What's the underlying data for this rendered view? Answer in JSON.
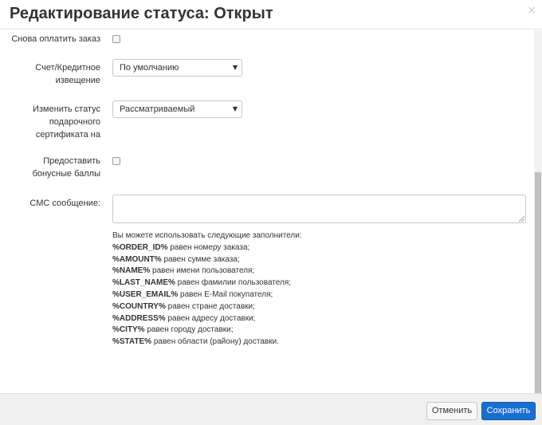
{
  "header": {
    "title": "Редактирование статуса: Открыт",
    "close_symbol": "×"
  },
  "form": {
    "repay_order": {
      "label": "Снова оплатить заказ",
      "checked": false
    },
    "invoice": {
      "label": "Счет/Кредитное извещение",
      "value": "По умолчанию"
    },
    "gift_cert": {
      "label": "Изменить статус подарочного сертификата на",
      "value": "Рассматриваемый"
    },
    "bonus": {
      "label": "Предоставить бонусные баллы",
      "checked": false
    },
    "sms": {
      "label": "СМС сообщение:",
      "value": ""
    }
  },
  "help": {
    "intro": "Вы можете использовать следующие заполнители:",
    "placeholders": [
      {
        "key": "%ORDER_ID%",
        "desc": " равен номеру заказа;"
      },
      {
        "key": "%AMOUNT%",
        "desc": " равен сумме заказа;"
      },
      {
        "key": "%NAME%",
        "desc": " равен имени пользователя;"
      },
      {
        "key": "%LAST_NAME%",
        "desc": " равен фамилии пользователя;"
      },
      {
        "key": "%USER_EMAIL%",
        "desc": " равен E-Mail покупателя;"
      },
      {
        "key": "%COUNTRY%",
        "desc": " равен стране доставки;"
      },
      {
        "key": "%ADDRESS%",
        "desc": " равен адресу доставки;"
      },
      {
        "key": "%CITY%",
        "desc": " равен городу доставки;"
      },
      {
        "key": "%STATE%",
        "desc": " равен области (району) доставки."
      }
    ]
  },
  "footer": {
    "cancel_label": "Отменить",
    "save_label": "Сохранить"
  },
  "icons": {
    "select_arrow": "▼"
  },
  "colors": {
    "primary": "#1a6ed1",
    "footer_bg": "#f0f0f0"
  }
}
